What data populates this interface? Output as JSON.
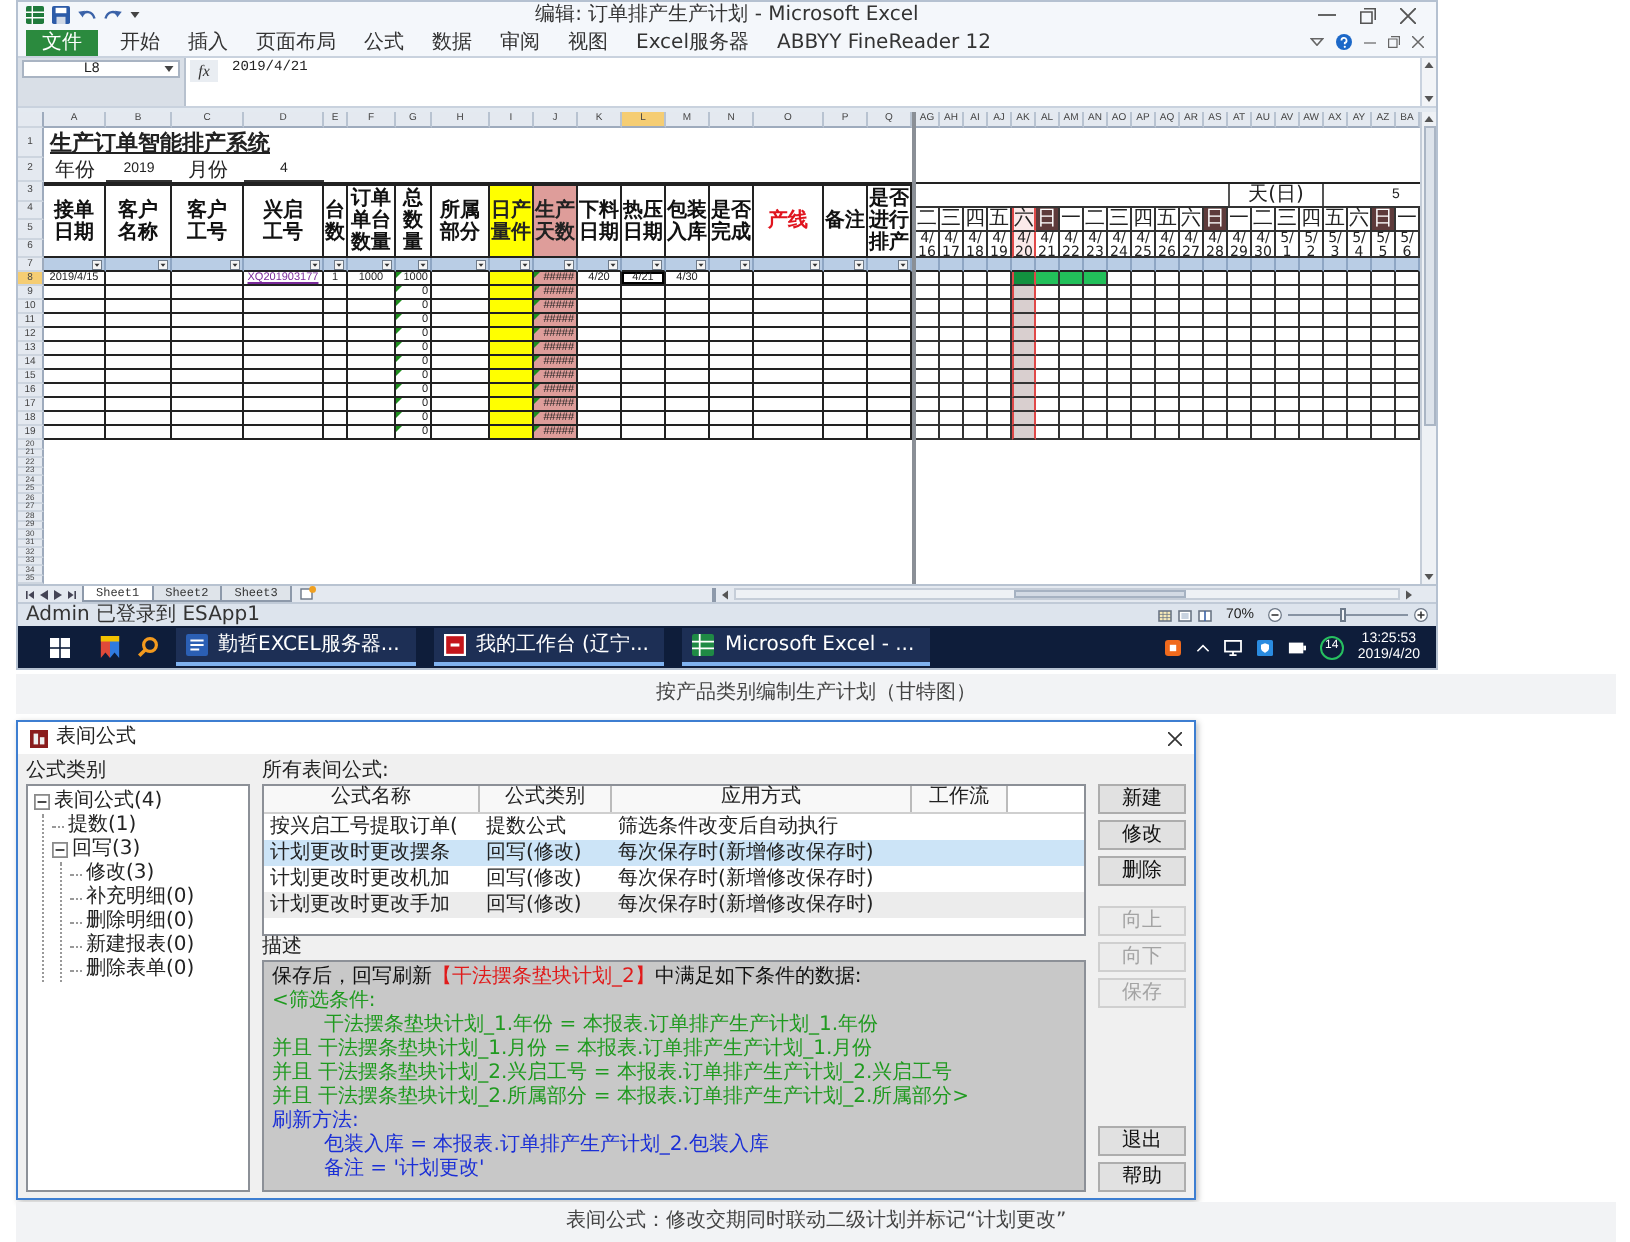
{
  "excel": {
    "title": "编辑: 订单排产生产计划 - Microsoft Excel",
    "file_button": "文件",
    "ribbon_tabs": [
      "开始",
      "插入",
      "页面布局",
      "公式",
      "数据",
      "审阅",
      "视图",
      "Excel服务器",
      "ABBYY FineReader 12"
    ],
    "name_box": "L8",
    "function_label": "fx",
    "formula": "2019/4/21",
    "columns": [
      {
        "letter": "A",
        "selected": false
      },
      {
        "letter": "B",
        "selected": false
      },
      {
        "letter": "C",
        "selected": false
      },
      {
        "letter": "D",
        "selected": false
      },
      {
        "letter": "E",
        "selected": false
      },
      {
        "letter": "F",
        "selected": false
      },
      {
        "letter": "G",
        "selected": false
      },
      {
        "letter": "H",
        "selected": false
      },
      {
        "letter": "I",
        "selected": false
      },
      {
        "letter": "J",
        "selected": false
      },
      {
        "letter": "K",
        "selected": false
      },
      {
        "letter": "L",
        "selected": true
      },
      {
        "letter": "M",
        "selected": false
      },
      {
        "letter": "N",
        "selected": false
      },
      {
        "letter": "O",
        "selected": false
      },
      {
        "letter": "P",
        "selected": false
      },
      {
        "letter": "Q",
        "selected": false
      }
    ],
    "gantt_columns": [
      "AG",
      "AH",
      "AI",
      "AJ",
      "AK",
      "AL",
      "AM",
      "AN",
      "AO",
      "AP",
      "AQ",
      "AR",
      "AS",
      "AT",
      "AU",
      "AV",
      "AW",
      "AX",
      "AY",
      "AZ",
      "BA"
    ],
    "top_row_numbers": [
      "1",
      "2"
    ],
    "sheet_title": "生产订单智能排产系统",
    "period": [
      {
        "label": "年份",
        "value": "2019"
      },
      {
        "label": "月份",
        "value": "4"
      }
    ],
    "header_row_numbers": [
      "3",
      "4",
      "5",
      "6"
    ],
    "headers": [
      {
        "text": "接单日期",
        "kind": "normal"
      },
      {
        "text": "客户名称",
        "kind": "normal"
      },
      {
        "text": "客户工号",
        "kind": "normal"
      },
      {
        "text": "兴启工号",
        "kind": "normal"
      },
      {
        "text": "台数",
        "kind": "normal"
      },
      {
        "text": "订单单台数量",
        "kind": "normal"
      },
      {
        "text": "总数量",
        "kind": "normal"
      },
      {
        "text": "所属部分",
        "kind": "normal"
      },
      {
        "text": "日产量件",
        "kind": "input"
      },
      {
        "text": "生产天数",
        "kind": "computed"
      },
      {
        "text": "下料日期",
        "kind": "normal"
      },
      {
        "text": "热压日期",
        "kind": "normal"
      },
      {
        "text": "包装入库",
        "kind": "normal"
      },
      {
        "text": "是否完成",
        "kind": "normal"
      },
      {
        "text": "产线",
        "kind": "emphasis"
      },
      {
        "text": "备注",
        "kind": "normal"
      },
      {
        "text": "是否进行排产",
        "kind": "normal"
      }
    ],
    "gantt_unit": {
      "label": "天(日)",
      "value": "5"
    },
    "days": [
      {
        "weekday": "二",
        "date": "4/16",
        "weekend": false,
        "today": false
      },
      {
        "weekday": "三",
        "date": "4/17",
        "weekend": false,
        "today": false
      },
      {
        "weekday": "四",
        "date": "4/18",
        "weekend": false,
        "today": false
      },
      {
        "weekday": "五",
        "date": "4/19",
        "weekend": false,
        "today": false
      },
      {
        "weekday": "六",
        "date": "4/20",
        "weekend": false,
        "today": true
      },
      {
        "weekday": "日",
        "date": "4/21",
        "weekend": true,
        "today": false
      },
      {
        "weekday": "一",
        "date": "4/22",
        "weekend": false,
        "today": false
      },
      {
        "weekday": "二",
        "date": "4/23",
        "weekend": false,
        "today": false
      },
      {
        "weekday": "三",
        "date": "4/24",
        "weekend": false,
        "today": false
      },
      {
        "weekday": "四",
        "date": "4/25",
        "weekend": false,
        "today": false
      },
      {
        "weekday": "五",
        "date": "4/26",
        "weekend": false,
        "today": false
      },
      {
        "weekday": "六",
        "date": "4/27",
        "weekend": false,
        "today": false
      },
      {
        "weekday": "日",
        "date": "4/28",
        "weekend": true,
        "today": false
      },
      {
        "weekday": "一",
        "date": "4/29",
        "weekend": false,
        "today": false
      },
      {
        "weekday": "二",
        "date": "4/30",
        "weekend": false,
        "today": false
      },
      {
        "weekday": "三",
        "date": "5/1",
        "weekend": false,
        "today": false
      },
      {
        "weekday": "四",
        "date": "5/2",
        "weekend": false,
        "today": false
      },
      {
        "weekday": "五",
        "date": "5/3",
        "weekend": false,
        "today": false
      },
      {
        "weekday": "六",
        "date": "5/4",
        "weekend": false,
        "today": false
      },
      {
        "weekday": "日",
        "date": "5/5",
        "weekend": true,
        "today": false
      },
      {
        "weekday": "一",
        "date": "5/6",
        "weekend": false,
        "today": false
      }
    ],
    "filter_row_number": "7",
    "rows": [
      {
        "number": "8",
        "selected": true,
        "cells": [
          {
            "text": "2019/4/15",
            "kind": "value",
            "selected": false,
            "flag": false
          },
          null,
          null,
          {
            "text": "XQ201903177",
            "kind": "link",
            "selected": false,
            "flag": false
          },
          {
            "text": "1",
            "kind": "value",
            "selected": false,
            "flag": false
          },
          {
            "text": "1000",
            "kind": "value",
            "selected": false,
            "flag": false
          },
          {
            "text": "1000",
            "kind": "value",
            "selected": false,
            "flag": true
          },
          null,
          null,
          {
            "text": "#####",
            "kind": "value",
            "selected": false,
            "flag": true
          },
          {
            "text": "4/20",
            "kind": "value",
            "selected": false,
            "flag": false
          },
          {
            "text": "4/21",
            "kind": "value",
            "selected": true,
            "flag": false
          },
          {
            "text": "4/30",
            "kind": "value",
            "selected": false,
            "flag": false
          },
          null,
          null,
          null,
          null
        ],
        "schedule": [
          false,
          false,
          false,
          false,
          true,
          true,
          true,
          true,
          false,
          false,
          false,
          false,
          false,
          false,
          false,
          false,
          false,
          false,
          false,
          false,
          false
        ]
      },
      {
        "number": "9",
        "selected": false,
        "cells": [
          null,
          null,
          null,
          null,
          null,
          null,
          {
            "text": "0",
            "kind": "value",
            "selected": false,
            "flag": true
          },
          null,
          null,
          {
            "text": "#####",
            "kind": "value",
            "selected": false,
            "flag": true
          },
          null,
          null,
          null,
          null,
          null,
          null,
          null
        ]
      },
      {
        "number": "10",
        "selected": false,
        "cells": [
          null,
          null,
          null,
          null,
          null,
          null,
          {
            "text": "0",
            "kind": "value",
            "selected": false,
            "flag": true
          },
          null,
          null,
          {
            "text": "#####",
            "kind": "value",
            "selected": false,
            "flag": true
          },
          null,
          null,
          null,
          null,
          null,
          null,
          null
        ]
      },
      {
        "number": "11",
        "selected": false,
        "cells": [
          null,
          null,
          null,
          null,
          null,
          null,
          {
            "text": "0",
            "kind": "value",
            "selected": false,
            "flag": true
          },
          null,
          null,
          {
            "text": "#####",
            "kind": "value",
            "selected": false,
            "flag": true
          },
          null,
          null,
          null,
          null,
          null,
          null,
          null
        ]
      },
      {
        "number": "12",
        "selected": false,
        "cells": [
          null,
          null,
          null,
          null,
          null,
          null,
          {
            "text": "0",
            "kind": "value",
            "selected": false,
            "flag": true
          },
          null,
          null,
          {
            "text": "#####",
            "kind": "value",
            "selected": false,
            "flag": true
          },
          null,
          null,
          null,
          null,
          null,
          null,
          null
        ]
      },
      {
        "number": "13",
        "selected": false,
        "cells": [
          null,
          null,
          null,
          null,
          null,
          null,
          {
            "text": "0",
            "kind": "value",
            "selected": false,
            "flag": true
          },
          null,
          null,
          {
            "text": "#####",
            "kind": "value",
            "selected": false,
            "flag": true
          },
          null,
          null,
          null,
          null,
          null,
          null,
          null
        ]
      },
      {
        "number": "14",
        "selected": false,
        "cells": [
          null,
          null,
          null,
          null,
          null,
          null,
          {
            "text": "0",
            "kind": "value",
            "selected": false,
            "flag": true
          },
          null,
          null,
          {
            "text": "#####",
            "kind": "value",
            "selected": false,
            "flag": true
          },
          null,
          null,
          null,
          null,
          null,
          null,
          null
        ]
      },
      {
        "number": "15",
        "selected": false,
        "cells": [
          null,
          null,
          null,
          null,
          null,
          null,
          {
            "text": "0",
            "kind": "value",
            "selected": false,
            "flag": true
          },
          null,
          null,
          {
            "text": "#####",
            "kind": "value",
            "selected": false,
            "flag": true
          },
          null,
          null,
          null,
          null,
          null,
          null,
          null
        ]
      },
      {
        "number": "16",
        "selected": false,
        "cells": [
          null,
          null,
          null,
          null,
          null,
          null,
          {
            "text": "0",
            "kind": "value",
            "selected": false,
            "flag": true
          },
          null,
          null,
          {
            "text": "#####",
            "kind": "value",
            "selected": false,
            "flag": true
          },
          null,
          null,
          null,
          null,
          null,
          null,
          null
        ]
      },
      {
        "number": "17",
        "selected": false,
        "cells": [
          null,
          null,
          null,
          null,
          null,
          null,
          {
            "text": "0",
            "kind": "value",
            "selected": false,
            "flag": true
          },
          null,
          null,
          {
            "text": "#####",
            "kind": "value",
            "selected": false,
            "flag": true
          },
          null,
          null,
          null,
          null,
          null,
          null,
          null
        ]
      },
      {
        "number": "18",
        "selected": false,
        "cells": [
          null,
          null,
          null,
          null,
          null,
          null,
          {
            "text": "0",
            "kind": "value",
            "selected": false,
            "flag": true
          },
          null,
          null,
          {
            "text": "#####",
            "kind": "value",
            "selected": false,
            "flag": true
          },
          null,
          null,
          null,
          null,
          null,
          null,
          null
        ]
      },
      {
        "number": "19",
        "selected": false,
        "cells": [
          null,
          null,
          null,
          null,
          null,
          null,
          {
            "text": "0",
            "kind": "value",
            "selected": false,
            "flag": true
          },
          null,
          null,
          {
            "text": "#####",
            "kind": "value",
            "selected": false,
            "flag": true
          },
          null,
          null,
          null,
          null,
          null,
          null,
          null
        ]
      }
    ],
    "empty_row_numbers": [
      "20",
      "21",
      "22",
      "23",
      "24",
      "25",
      "26",
      "27",
      "28",
      "29",
      "30",
      "31",
      "32",
      "33",
      "34",
      "35"
    ],
    "sheet_tabs": [
      {
        "label": "Sheet1",
        "selected": true
      },
      {
        "label": "Sheet2",
        "selected": false
      },
      {
        "label": "Sheet3",
        "selected": false
      }
    ],
    "status_text": "Admin 已登录到 ESApp1",
    "zoom": {
      "label": "70%",
      "level": 0.45
    }
  },
  "taskbar": {
    "apps": [
      {
        "label": "勤哲EXCEL服务器...",
        "kind": "document"
      },
      {
        "label": "我的工作台 (辽宁...",
        "kind": "browser"
      },
      {
        "label": "Microsoft Excel - ...",
        "kind": "spreadsheet"
      }
    ],
    "badge": "14",
    "time": "13:25:53",
    "date": "2019/4/20"
  },
  "caption_1": "按产品类别编制生产计划（甘特图）",
  "dialog": {
    "title": "表间公式",
    "category_label": "公式类别",
    "tree": [
      {
        "label": "表间公式(4)",
        "expanded": true,
        "children": [
          {
            "label": "提数(1)"
          },
          {
            "label": "回写(3)",
            "expanded": true,
            "children": [
              {
                "label": "修改(3)"
              },
              {
                "label": "补充明细(0)"
              },
              {
                "label": "删除明细(0)"
              },
              {
                "label": "新建报表(0)"
              },
              {
                "label": "删除表单(0)"
              }
            ]
          }
        ]
      }
    ],
    "list_label": "所有表间公式:",
    "columns": [
      "公式名称",
      "公式类别",
      "应用方式",
      "工作流"
    ],
    "formulas": [
      {
        "name": "按兴启工号提取订单(",
        "category": "提数公式",
        "mode": "筛选条件改变后自动执行",
        "selected": false
      },
      {
        "name": "计划更改时更改摆条",
        "category": "回写(修改)",
        "mode": "每次保存时(新增修改保存时)",
        "selected": true
      },
      {
        "name": "计划更改时更改机加",
        "category": "回写(修改)",
        "mode": "每次保存时(新增修改保存时)",
        "selected": false
      },
      {
        "name": "计划更改时更改手加",
        "category": "回写(修改)",
        "mode": "每次保存时(新增修改保存时)",
        "selected": false
      }
    ],
    "edit_buttons": [
      {
        "label": "新建",
        "disabled": false
      },
      {
        "label": "修改",
        "disabled": false
      },
      {
        "label": "删除",
        "disabled": false
      }
    ],
    "order_buttons": [
      {
        "label": "向上",
        "disabled": true
      },
      {
        "label": "向下",
        "disabled": true
      },
      {
        "label": "保存",
        "disabled": true
      }
    ],
    "description_label": "描述",
    "description": [
      {
        "kind": "intro",
        "text": "保存后，回写刷新",
        "target": "【干法摆条垫块计划_2】",
        "rest": "中满足如下条件的数据:"
      },
      {
        "kind": "condition_head",
        "text": "<筛选条件:"
      },
      {
        "kind": "condition",
        "text": "干法摆条垫块计划_1.年份 = 本报表.订单排产生产计划_1.年份"
      },
      {
        "kind": "condition_and",
        "text": "并且 干法摆条垫块计划_1.月份 = 本报表.订单排产生产计划_1.月份"
      },
      {
        "kind": "condition_and",
        "text": "并且 干法摆条垫块计划_2.兴启工号 = 本报表.订单排产生产计划_2.兴启工号"
      },
      {
        "kind": "condition_and",
        "text": "并且 干法摆条垫块计划_2.所属部分 = 本报表.订单排产生产计划_2.所属部分>"
      },
      {
        "kind": "method_head",
        "text": "刷新方法:"
      },
      {
        "kind": "method",
        "text": "包装入库 = 本报表.订单排产生产计划_2.包装入库"
      },
      {
        "kind": "method",
        "text": "备注 = '计划更改'"
      }
    ],
    "bottom_buttons": [
      "退出",
      "帮助"
    ]
  },
  "caption_2": "表间公式：修改交期同时联动二级计划并标记“计划更改”"
}
